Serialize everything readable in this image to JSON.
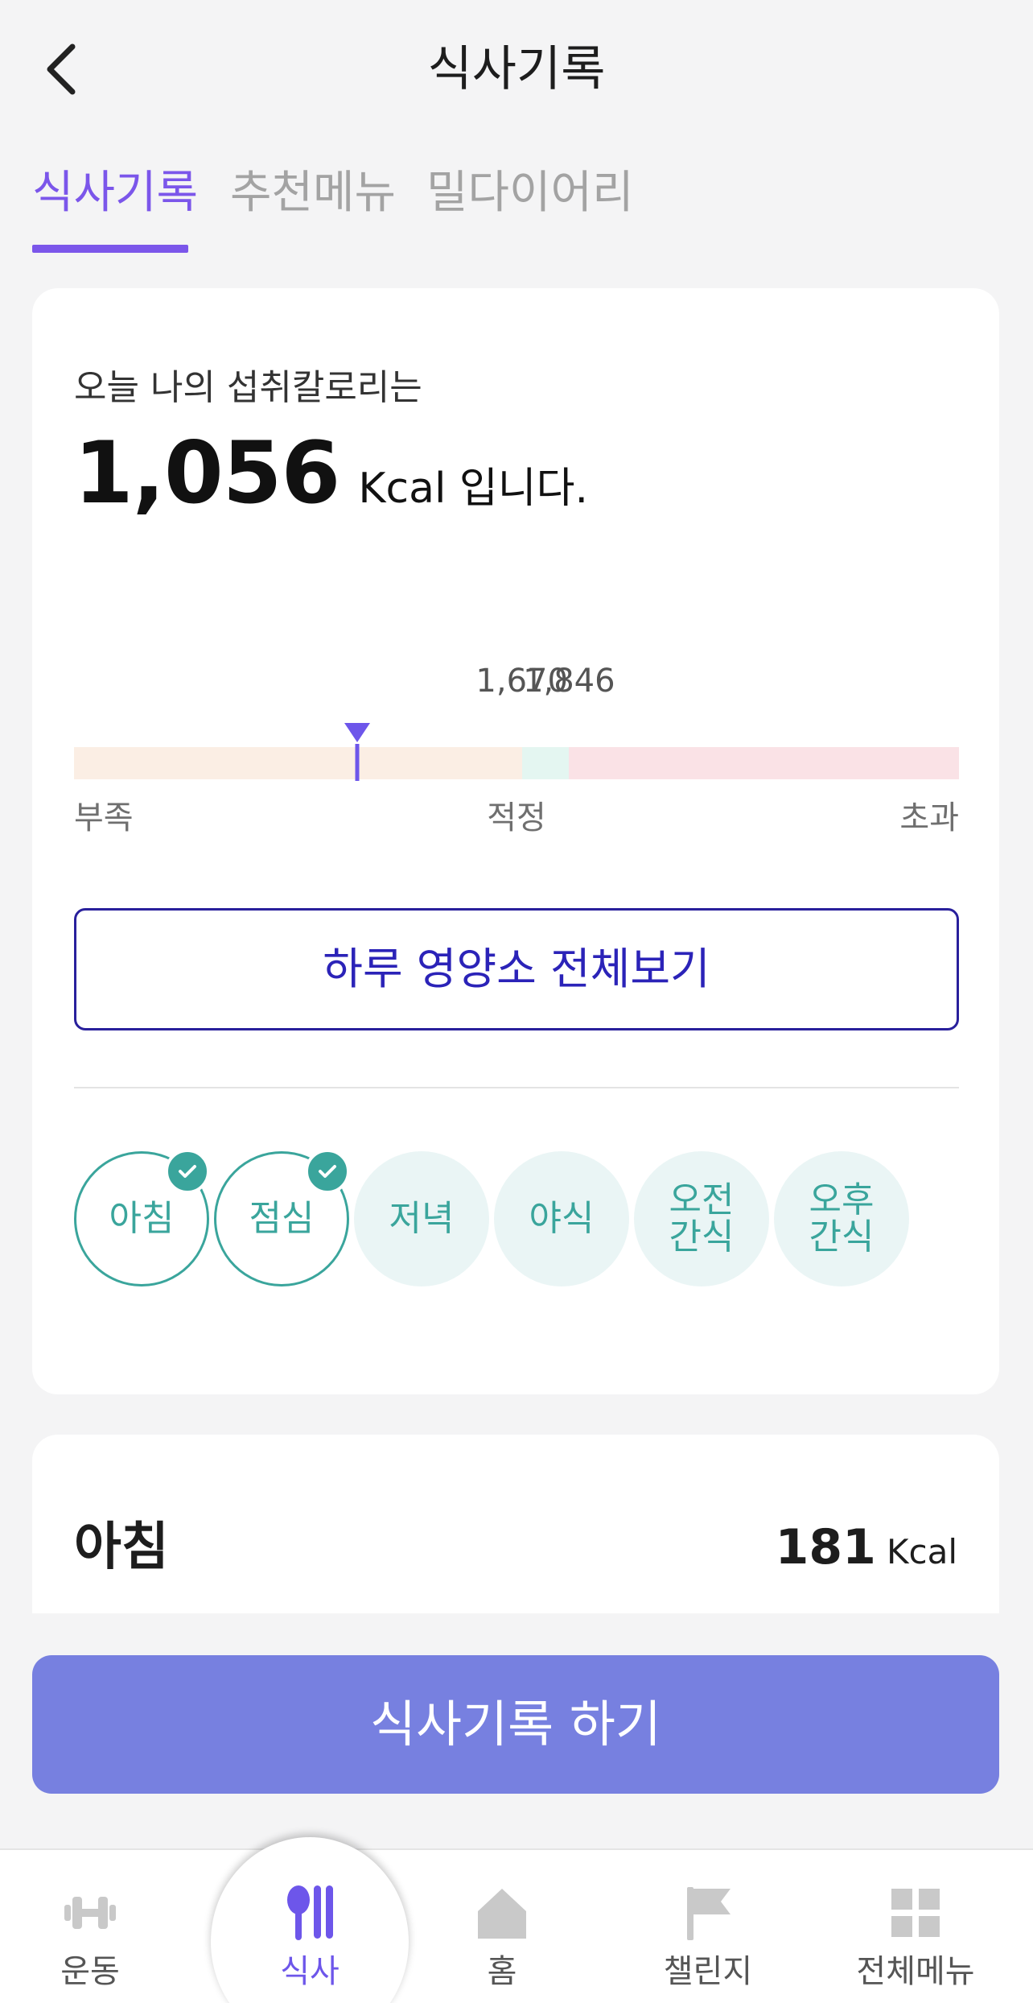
{
  "header": {
    "title": "식사기록",
    "back_icon": "chevron-left-icon"
  },
  "tabs": [
    {
      "label": "식사기록",
      "active": true
    },
    {
      "label": "추천메뉴",
      "active": false
    },
    {
      "label": "밀다이어리",
      "active": false
    }
  ],
  "summary": {
    "intro": "오늘 나의 섭취칼로리는",
    "kcal_value": "1,056",
    "kcal_suffix": "Kcal 입니다.",
    "gauge": {
      "current": 1056,
      "range_min": 0,
      "range_max": 3300,
      "low_max": 1670,
      "high_min": 1846,
      "tick_low": "1,670",
      "tick_high": "1,846",
      "zone_low": "부족",
      "zone_ok": "적정",
      "zone_high": "초과",
      "colors": {
        "low": "#fbeee4",
        "ok": "#e4f6f1",
        "high": "#fae2e6",
        "marker": "#6d56ea"
      }
    },
    "nutrient_button": "하루 영양소 전체보기"
  },
  "meals": [
    {
      "label": "아침",
      "done": true
    },
    {
      "label": "점심",
      "done": true
    },
    {
      "label": "저녁",
      "done": false
    },
    {
      "label": "야식",
      "done": false
    },
    {
      "label": "오전\n간식",
      "done": false
    },
    {
      "label": "오후\n간식",
      "done": false
    }
  ],
  "meal_card": {
    "title": "아침",
    "kcal_num": "181",
    "kcal_unit": "Kcal"
  },
  "record_button": "식사기록 하기",
  "bottom_nav": [
    {
      "label": "운동",
      "icon": "dumbbell-icon",
      "active": false
    },
    {
      "label": "식사",
      "icon": "spoon-fork-icon",
      "active": true
    },
    {
      "label": "홈",
      "icon": "home-icon",
      "active": false
    },
    {
      "label": "챌린지",
      "icon": "flag-icon",
      "active": false
    },
    {
      "label": "전체메뉴",
      "icon": "grid-icon",
      "active": false
    }
  ],
  "colors": {
    "accent": "#7b56ea",
    "teal": "#3aa59c",
    "button_primary": "#7780e0",
    "outline_button": "#29209c"
  }
}
